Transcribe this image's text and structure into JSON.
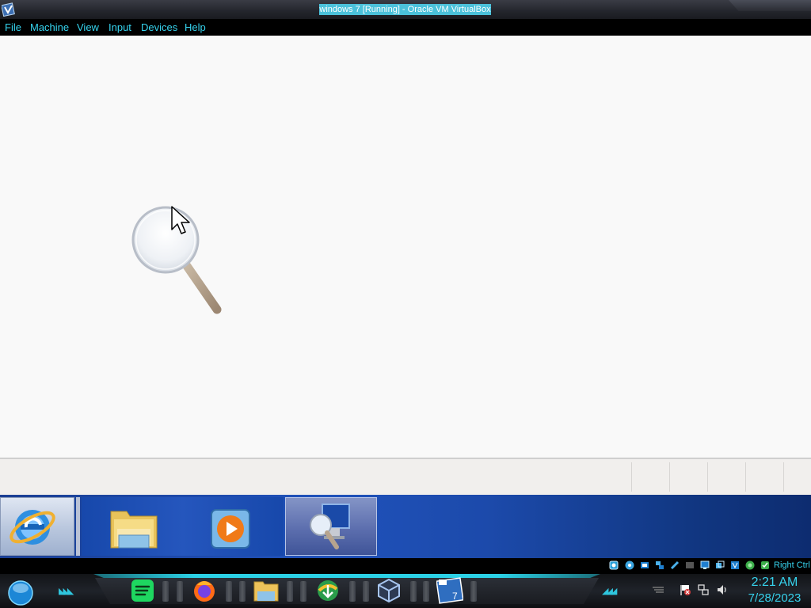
{
  "window": {
    "title": "windows 7 [Running] - Oracle VM VirtualBox"
  },
  "menu": {
    "items": [
      "File",
      "Machine",
      "View",
      "Input",
      "Devices",
      "Help"
    ]
  },
  "vm_taskbar": {
    "items": [
      {
        "name": "internet-explorer-icon",
        "active": true
      },
      {
        "name": "windows-explorer-icon",
        "active": false
      },
      {
        "name": "media-player-icon",
        "active": false
      },
      {
        "name": "magnifier-icon",
        "active": true
      }
    ]
  },
  "vbox_status": {
    "host_key": "Right Ctrl",
    "indicators": [
      "hard-disk-icon",
      "optical-disk-icon",
      "audio-icon",
      "network-icon",
      "usb-icon",
      "shared-folders-icon",
      "display-icon",
      "video-capture-icon",
      "cpu-icon",
      "mouse-integration-icon",
      "keyboard-icon"
    ]
  },
  "host_taskbar": {
    "pinned": [
      "spotify-icon",
      "firefox-icon",
      "file-explorer-icon",
      "download-manager-icon",
      "virtualbox-icon",
      "windows7-vm-icon"
    ],
    "clock": {
      "time": "2:21 AM",
      "date": "7/28/2023"
    }
  },
  "colors": {
    "accent": "#36d3ee",
    "title_highlight": "#4bc1da",
    "vm_taskbar_blue": "#2052bb"
  }
}
